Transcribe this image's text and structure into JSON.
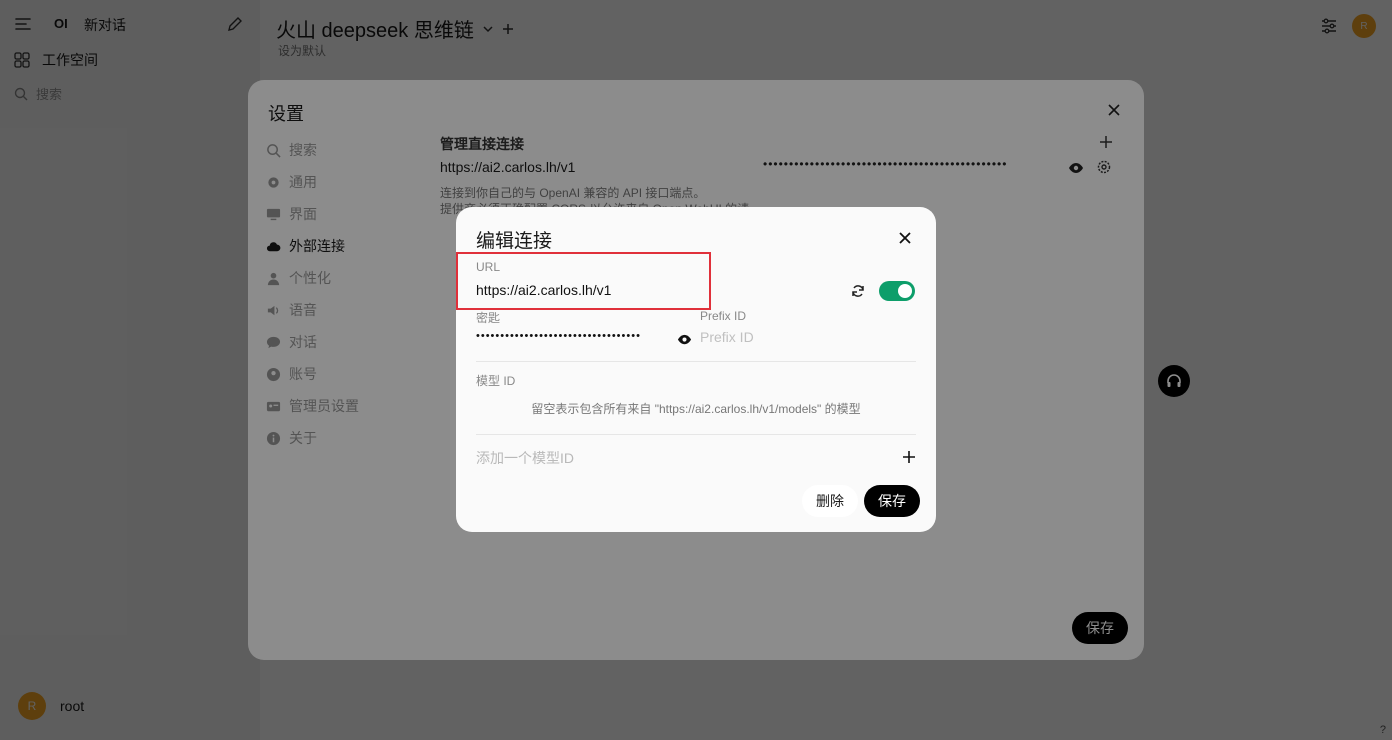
{
  "sidebar": {
    "logo": "OI",
    "new_chat": "新对话",
    "workspace": "工作空间",
    "search_placeholder": "搜索",
    "user_initial": "R",
    "user_name": "root"
  },
  "topbar": {
    "model_name": "火山 deepseek 思维链",
    "set_default": "设为默认",
    "user_initial": "R"
  },
  "settings": {
    "title": "设置",
    "nav": [
      {
        "label": "搜索",
        "icon": "search-icon"
      },
      {
        "label": "通用",
        "icon": "gear-icon"
      },
      {
        "label": "界面",
        "icon": "monitor-icon"
      },
      {
        "label": "外部连接",
        "icon": "cloud-icon",
        "active": true
      },
      {
        "label": "个性化",
        "icon": "person-icon"
      },
      {
        "label": "语音",
        "icon": "speaker-icon"
      },
      {
        "label": "对话",
        "icon": "chat-icon"
      },
      {
        "label": "账号",
        "icon": "account-icon"
      },
      {
        "label": "管理员设置",
        "icon": "admin-icon"
      },
      {
        "label": "关于",
        "icon": "info-icon"
      }
    ],
    "connections_heading": "管理直接连接",
    "connection_url": "https://ai2.carlos.lh/v1",
    "connection_key_masked": "•••••••••••••••••••••••••••••••••••••••••••••••",
    "description": "连接到你自己的与 OpenAI 兼容的 API 接口端点。\n提供商必须正确配置 CORS 以允许来自 Open WebUI 的请求。",
    "save_label": "保存"
  },
  "dialog": {
    "title": "编辑连接",
    "url_label": "URL",
    "url_value": "https://ai2.carlos.lh/v1",
    "toggle_enabled": true,
    "key_label": "密匙",
    "key_masked": "••••••••••••••••••••••••••••••••••",
    "prefix_label": "Prefix ID",
    "prefix_placeholder": "Prefix ID",
    "model_id_label": "模型 ID",
    "model_hint": "留空表示包含所有来自 \"https://ai2.carlos.lh/v1/models\" 的模型",
    "add_model_placeholder": "添加一个模型ID",
    "delete_label": "删除",
    "save_label": "保存"
  },
  "help_label": "?",
  "colors": {
    "accent_toggle": "#0d9e6a",
    "highlight_box": "#e0303a",
    "avatar": "#f5a623"
  }
}
